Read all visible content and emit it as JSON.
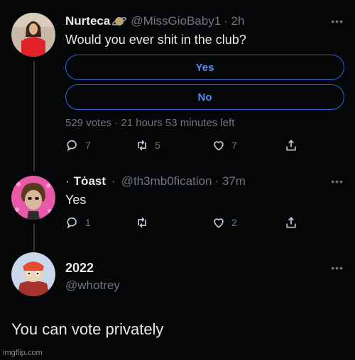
{
  "tweet1": {
    "display_name": "Nurteca",
    "handle": "@MissGioBaby1",
    "time": "· 2h",
    "text": "Would you ever shit in the club?",
    "poll_options": [
      "Yes",
      "No"
    ],
    "poll_meta": "529 votes · 21 hours 53 minutes left",
    "reply_count": "7",
    "retweet_count": "5",
    "like_count": "7",
    "more": "•••"
  },
  "tweet2": {
    "prefix": "·",
    "display_name": "Tȯast",
    "handle": "@th3mb0fication",
    "time": "· 37m",
    "text": "Yes",
    "reply_count": "1",
    "like_count": "2",
    "more": "•••"
  },
  "account": {
    "display_name": "2022",
    "handle": "@whotrey",
    "more": "•••"
  },
  "caption": "You can vote privately",
  "watermark": "imgflip.com",
  "colors": {
    "background": "#050608",
    "poll_border": "#2e64d6",
    "poll_text": "#5b8df6",
    "muted": "#71767b"
  }
}
